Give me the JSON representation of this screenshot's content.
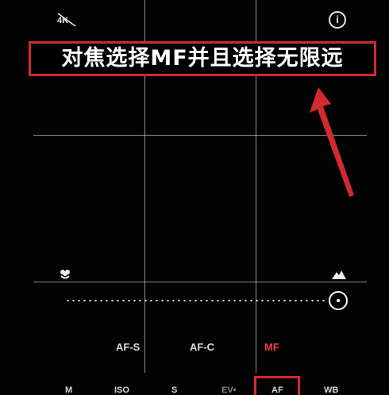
{
  "top": {
    "left_icon": "4k-icon",
    "right_icon": "info-icon",
    "info_glyph": "i"
  },
  "annotation": {
    "text": "对焦选择MF并且选择无限远",
    "border_color": "#d22a2f"
  },
  "focus_slider": {
    "near_icon": "flower-macro-icon",
    "far_icon": "mountain-infinity-icon",
    "position": 1.0
  },
  "focus_modes": [
    {
      "label": "AF-S",
      "selected": false
    },
    {
      "label": "AF-C",
      "selected": false
    },
    {
      "label": "MF",
      "selected": true,
      "color": "#e8413c"
    }
  ],
  "bottom_bar": [
    {
      "label": "M"
    },
    {
      "label": "ISO"
    },
    {
      "label": "S"
    },
    {
      "label": "EV•"
    },
    {
      "label": "AF",
      "highlighted": true
    },
    {
      "label": "WB"
    }
  ]
}
